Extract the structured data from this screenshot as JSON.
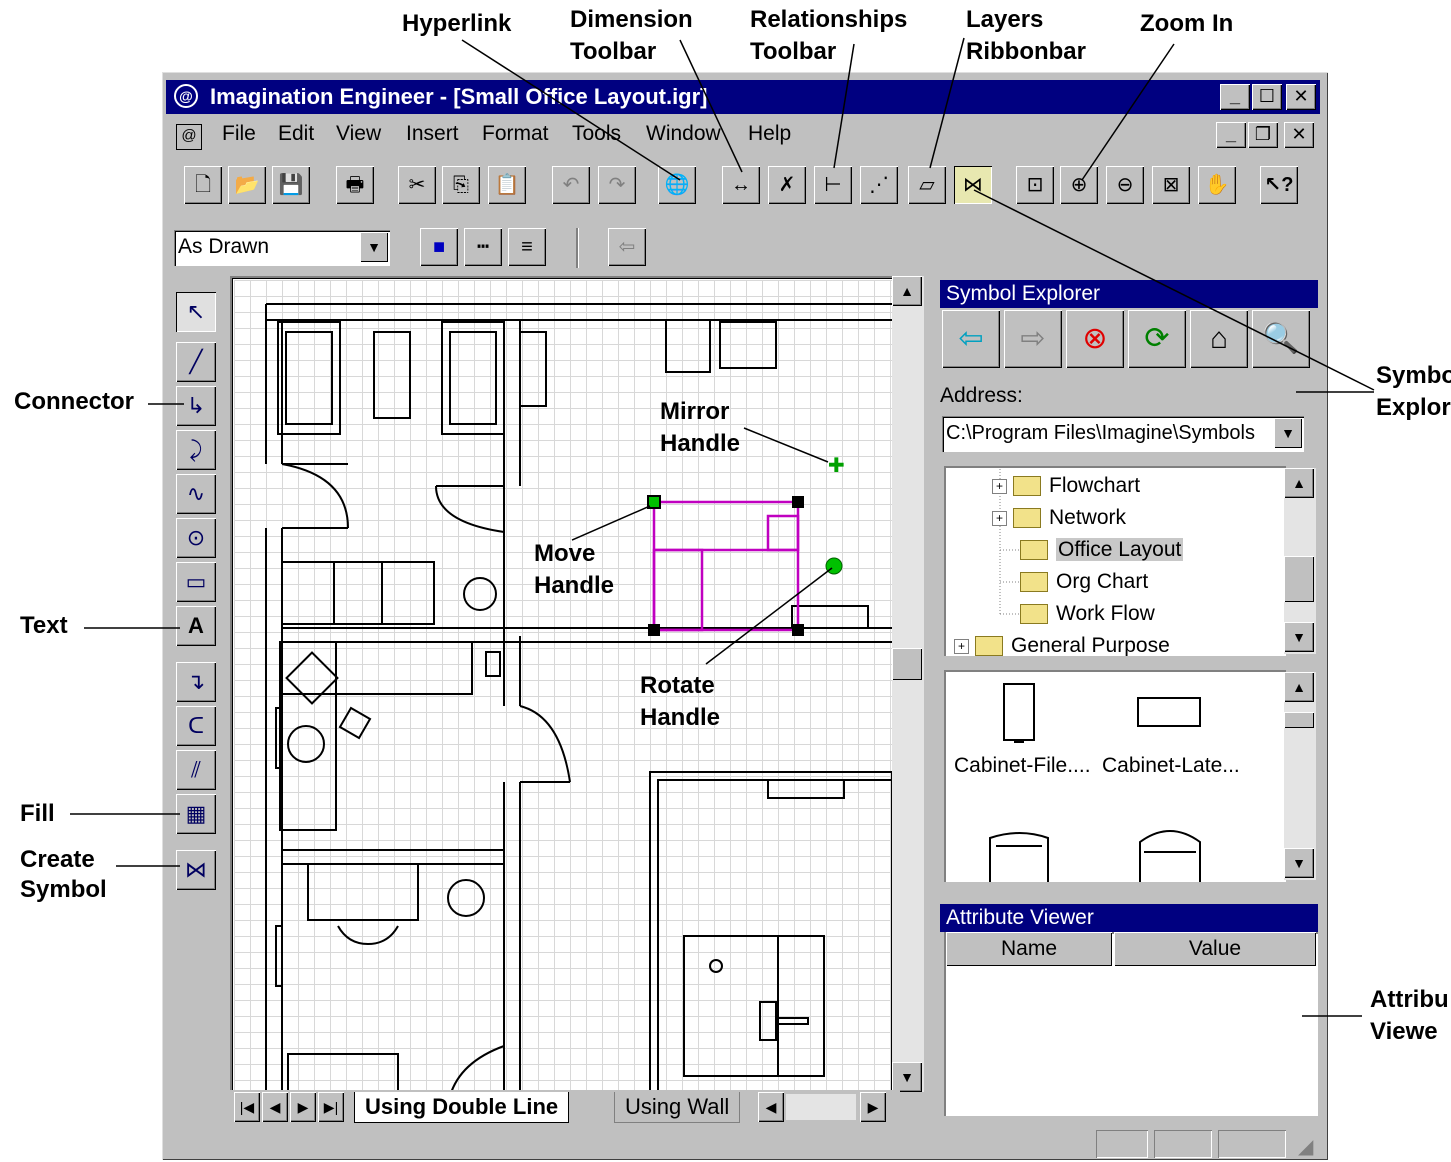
{
  "annotations": {
    "hyperlink": "Hyperlink",
    "dimension_1": "Dimension",
    "dimension_2": "Toolbar",
    "relationships_1": "Relationships",
    "relationships_2": "Toolbar",
    "layers_1": "Layers",
    "layers_2": "Ribbonbar",
    "zoom_in": "Zoom In",
    "connector": "Connector",
    "text": "Text",
    "fill": "Fill",
    "create_symbol_1": "Create",
    "create_symbol_2": "Symbol",
    "symbol_explorer_1": "Symbo",
    "symbol_explorer_2": "Explor",
    "attribute_viewer_1": "Attribu",
    "attribute_viewer_2": "Viewe",
    "mirror_1": "Mirror",
    "mirror_2": "Handle",
    "move_1": "Move",
    "move_2": "Handle",
    "rotate_1": "Rotate",
    "rotate_2": "Handle"
  },
  "window": {
    "title": "Imagination Engineer - [Small Office Layout.igr]"
  },
  "menu": {
    "items": [
      "File",
      "Edit",
      "View",
      "Insert",
      "Format",
      "Tools",
      "Window",
      "Help"
    ]
  },
  "format_bar": {
    "line_style": "As Drawn"
  },
  "sheet_tabs": {
    "tabs": [
      "Using Double Line",
      "Using Wall"
    ]
  },
  "symbol_explorer": {
    "title": "Symbol Explorer",
    "address_label": "Address:",
    "address_value": "C:\\Program Files\\Imagine\\Symbols",
    "tree": [
      {
        "label": "Flowchart"
      },
      {
        "label": "Network"
      },
      {
        "label": "Office Layout",
        "selected": true
      },
      {
        "label": "Org Chart"
      },
      {
        "label": "Work Flow"
      },
      {
        "label": "General Purpose"
      }
    ],
    "symbols": [
      {
        "label": "Cabinet-File...."
      },
      {
        "label": "Cabinet-Late..."
      }
    ]
  },
  "attribute_viewer": {
    "title": "Attribute Viewer",
    "columns": [
      "Name",
      "Value"
    ]
  },
  "colors": {
    "title_bar": "#000080",
    "window_face": "#c0c0c0",
    "selection": "#c000c0",
    "handle_green": "#00c000"
  }
}
